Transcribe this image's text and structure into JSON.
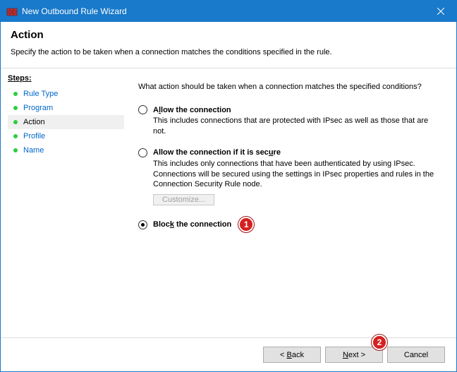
{
  "window": {
    "title": "New Outbound Rule Wizard"
  },
  "header": {
    "title": "Action",
    "description": "Specify the action to be taken when a connection matches the conditions specified in the rule."
  },
  "steps": {
    "title": "Steps:",
    "items": [
      {
        "label": "Rule Type",
        "current": false
      },
      {
        "label": "Program",
        "current": false
      },
      {
        "label": "Action",
        "current": true
      },
      {
        "label": "Profile",
        "current": false
      },
      {
        "label": "Name",
        "current": false
      }
    ]
  },
  "content": {
    "question": "What action should be taken when a connection matches the specified conditions?",
    "options": {
      "allow": {
        "label_html": "A<span class='u'>l</span>low the connection",
        "desc": "This includes connections that are protected with IPsec as well as those that are not.",
        "checked": false
      },
      "allow_secure": {
        "label_html": "Allow the connection if it is sec<span class='u'>u</span>re",
        "desc": "This includes only connections that have been authenticated by using IPsec.  Connections will be secured using the settings in IPsec properties and rules in the Connection Security Rule node.",
        "checked": false,
        "customize_label": "Customize..."
      },
      "block": {
        "label_html": "Bloc<span class='u'>k</span> the connection",
        "checked": true
      }
    }
  },
  "footer": {
    "back_html": "< <span class='u'>B</span>ack",
    "next_html": "<span class='u'>N</span>ext >",
    "cancel": "Cancel"
  },
  "annotations": {
    "one": "1",
    "two": "2"
  }
}
